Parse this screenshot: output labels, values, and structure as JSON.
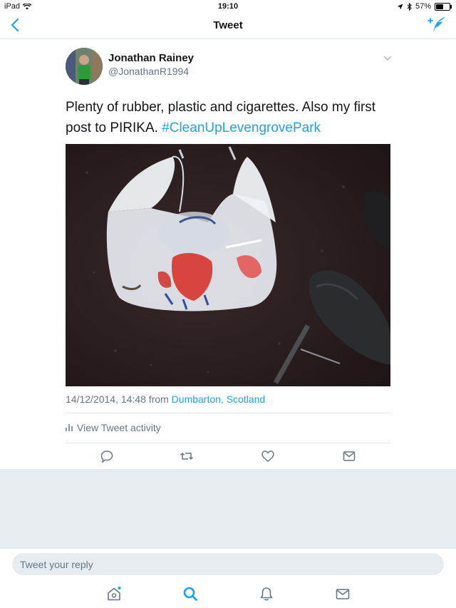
{
  "status_bar": {
    "device": "iPad",
    "time": "19:10",
    "battery": "57%",
    "battery_level": 0.57
  },
  "nav": {
    "title": "Tweet"
  },
  "tweet": {
    "author_name": "Jonathan Rainey",
    "author_handle": "@JonathanR1994",
    "text": "Plenty of rubber, plastic and cigarettes. Also my first post to PIRIKA. ",
    "hashtag": "#CleanUpLevengrovePark",
    "timestamp": "14/12/2014, 14:48 from ",
    "location": "Dumbarton, Scotland",
    "activity_label": "View Tweet activity"
  },
  "reply": {
    "placeholder": "Tweet your reply"
  },
  "icons": {
    "back": "chevron-left-icon",
    "compose": "compose-tweet-icon",
    "more": "chevron-down-icon",
    "reply": "reply-icon",
    "retweet": "retweet-icon",
    "like": "heart-icon",
    "dm": "direct-message-icon",
    "home": "home-icon",
    "search": "search-icon",
    "notifications": "bell-icon",
    "messages": "envelope-icon"
  },
  "colors": {
    "accent": "#1da1f2",
    "secondary_text": "#657786",
    "background_grey": "#e6ecf0"
  }
}
